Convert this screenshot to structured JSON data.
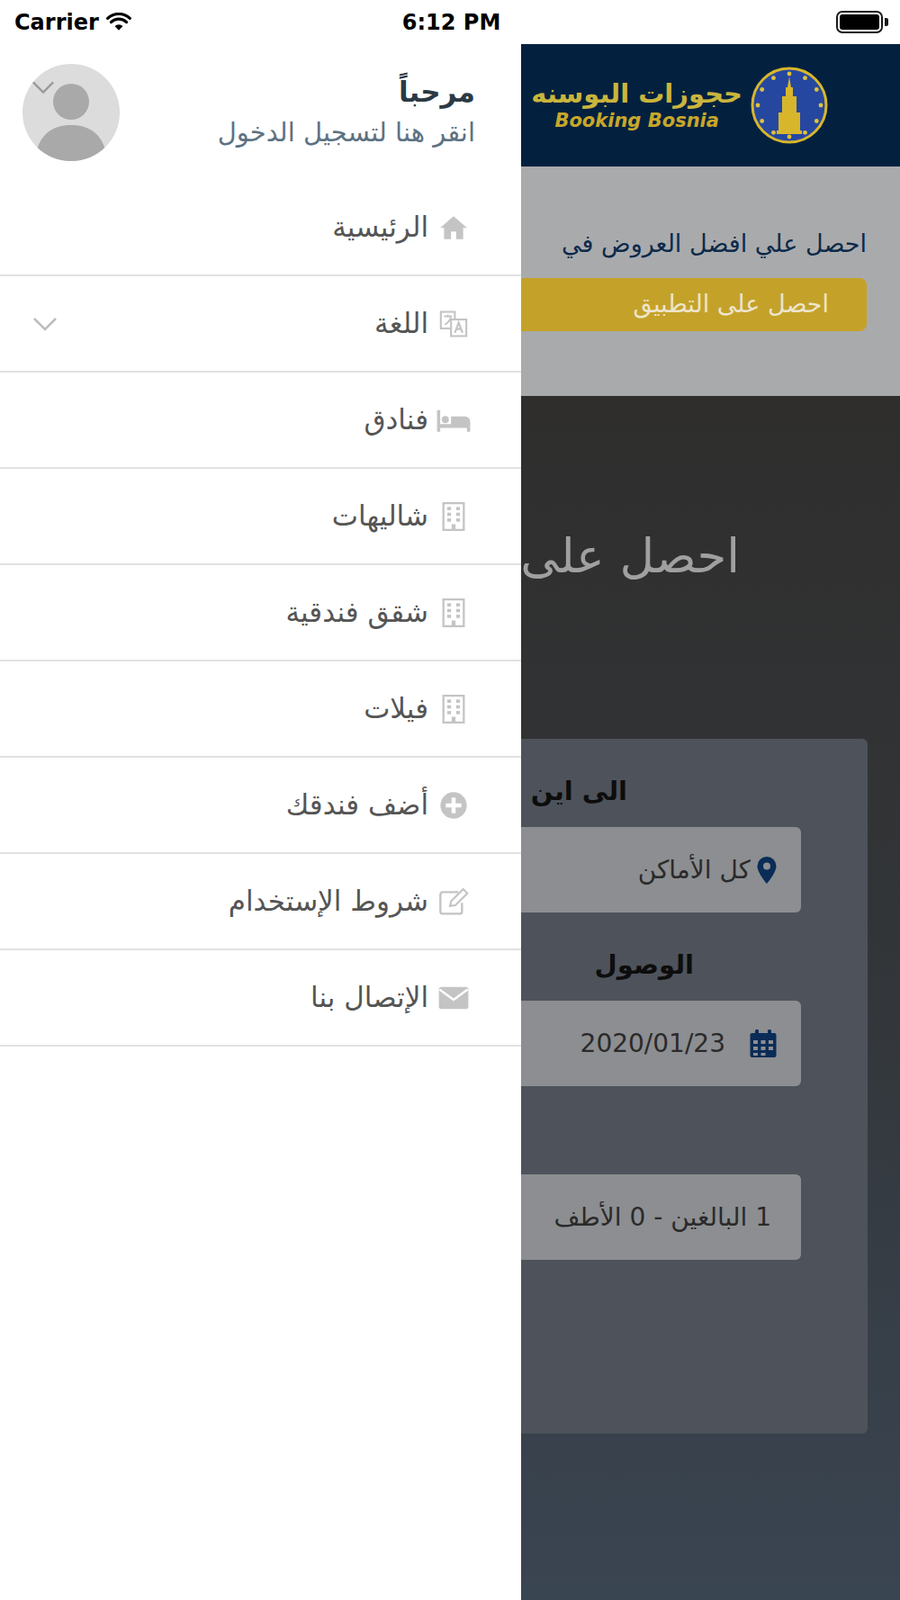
{
  "status_bar": {
    "carrier": "Carrier",
    "time": "6:12 PM",
    "battery_level": 1
  },
  "drawer": {
    "greeting": "مرحباً",
    "login_prompt": "انقر هنا لتسجيل الدخول",
    "items": [
      {
        "label": "الرئيسية",
        "kind": "link"
      },
      {
        "label": "اللغة",
        "kind": "submenu",
        "expanded": false
      },
      {
        "label": "فنادق",
        "kind": "link"
      },
      {
        "label": "شاليهات",
        "kind": "link"
      },
      {
        "label": "شقق فندقية",
        "kind": "link"
      },
      {
        "label": "فيلات",
        "kind": "link"
      },
      {
        "label": "أضف فندقك",
        "kind": "link"
      },
      {
        "label": "شروط الإستخدام",
        "kind": "link"
      },
      {
        "label": "الإتصال بنا",
        "kind": "link"
      }
    ]
  },
  "app": {
    "logo": {
      "arabic": "حجوزات البوسنه",
      "latin": "Booking Bosnia"
    },
    "banner": {
      "text": "احصل علي افضل العروض في",
      "button": "احصل على التطبيق"
    },
    "hero_title": "احصل على",
    "search_fields": [
      {
        "label": "الى اين",
        "value": "كل الأماكن",
        "kind": "place"
      },
      {
        "label": "الوصول",
        "value": "2020/01/23",
        "kind": "date"
      },
      {
        "value": "1 البالغين - 0 الأطف",
        "kind": "guests"
      }
    ]
  }
}
